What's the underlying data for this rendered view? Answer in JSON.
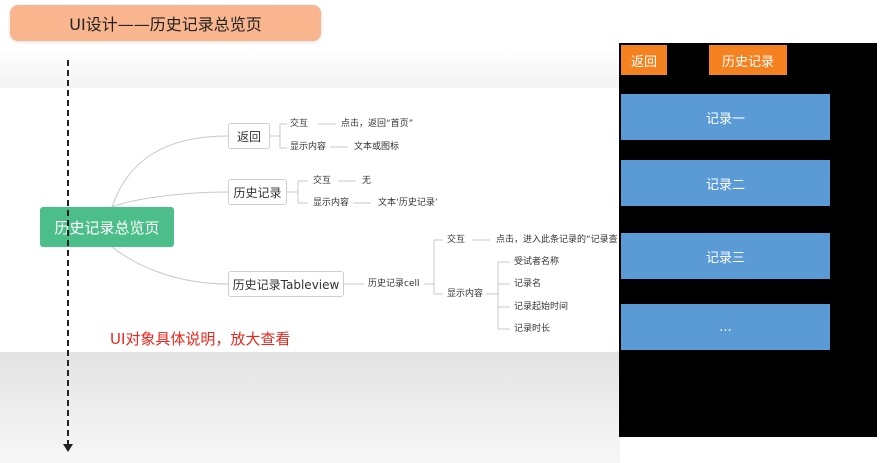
{
  "title": "UI设计——历史记录总览页",
  "mindmap": {
    "root": "历史记录总览页",
    "back": {
      "label": "返回",
      "interaction_key": "交互",
      "interaction_value": "点击，返回“首页”",
      "display_key": "显示内容",
      "display_value": "文本或图标"
    },
    "history": {
      "label": "历史记录",
      "interaction_key": "交互",
      "interaction_value": "无",
      "display_key": "显示内容",
      "display_value": "文本‘历史记录’"
    },
    "tableview": {
      "label": "历史记录Tableview",
      "cell": "历史记录cell",
      "interaction_key": "交互",
      "interaction_value": "点击，进入此条记录的“记录查",
      "display_key": "显示内容",
      "display_items": [
        "受试者名称",
        "记录名",
        "记录起始时间",
        "记录时长"
      ]
    }
  },
  "note": "UI对象具体说明，放大查看",
  "phone": {
    "back_button": "返回",
    "title_button": "历史记录",
    "records": [
      "记录一",
      "记录二",
      "记录三",
      "..."
    ]
  },
  "colors": {
    "title_pill": "#f8b58e",
    "root_node": "#4cbe8a",
    "note_text": "#e8261c",
    "phone_bg": "#000000",
    "orange_button": "#f58220",
    "record_blue": "#5b9bd5"
  }
}
